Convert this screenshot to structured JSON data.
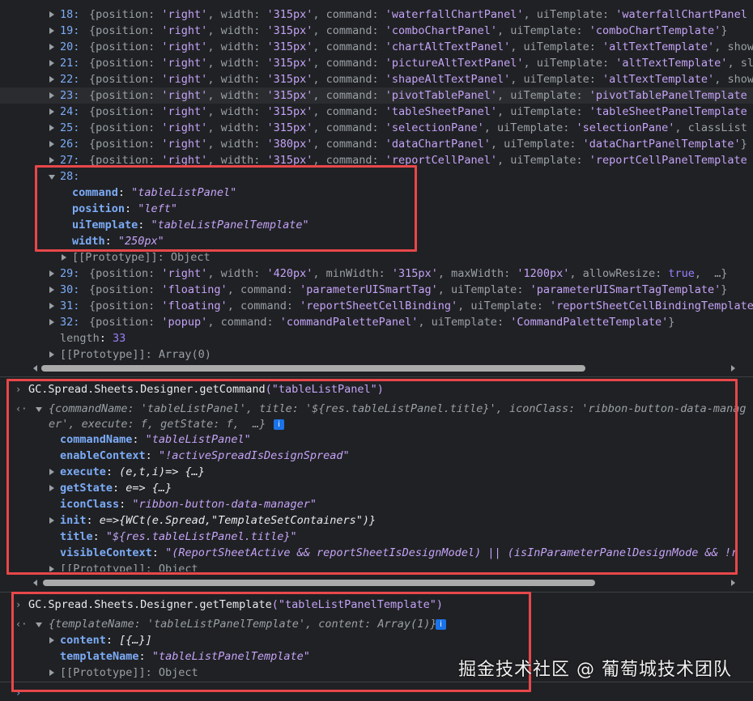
{
  "console": {
    "array_items": [
      {
        "index": "18:",
        "text": "{position: 'right', width: '315px', command: 'waterfallChartPanel', uiTemplate: 'waterfallChartPanel"
      },
      {
        "index": "19:",
        "text": "{position: 'right', width: '315px', command: 'comboChartPanel', uiTemplate: 'comboChartTemplate'}"
      },
      {
        "index": "20:",
        "text": "{position: 'right', width: '315px', command: 'chartAltTextPanel', uiTemplate: 'altTextTemplate', show"
      },
      {
        "index": "21:",
        "text": "{position: 'right', width: '315px', command: 'pictureAltTextPanel', uiTemplate: 'altTextTemplate', sl"
      },
      {
        "index": "22:",
        "text": "{position: 'right', width: '315px', command: 'shapeAltTextPanel', uiTemplate: 'altTextTemplate', show"
      },
      {
        "index": "23:",
        "text": "{position: 'right', width: '315px', command: 'pivotTablePanel', uiTemplate: 'pivotTablePanelTemplate"
      },
      {
        "index": "24:",
        "text": "{position: 'right', width: '315px', command: 'tableSheetPanel', uiTemplate: 'tableSheetPanelTemplate"
      },
      {
        "index": "25:",
        "text": "{position: 'right', width: '315px', command: 'selectionPane', uiTemplate: 'selectionPane', classList"
      },
      {
        "index": "26:",
        "text": "{position: 'right', width: '380px', command: 'dataChartPanel', uiTemplate: 'dataChartPanelTemplate'}"
      },
      {
        "index": "27:",
        "text": "{position: 'right', width: '315px', command: 'reportCellPanel', uiTemplate: 'reportCellPanelTemplate"
      }
    ],
    "item28": {
      "index": "28:",
      "props": [
        {
          "key": "command",
          "value": "\"tableListPanel\""
        },
        {
          "key": "position",
          "value": "\"left\""
        },
        {
          "key": "uiTemplate",
          "value": "\"tableListPanelTemplate\""
        },
        {
          "key": "width",
          "value": "\"250px\""
        }
      ],
      "prototype": "[[Prototype]]: Object"
    },
    "array_items_2": [
      {
        "index": "29:",
        "text": "{position: 'right', width: '420px', minWidth: '315px', maxWidth: '1200px', allowResize: true,  …}"
      },
      {
        "index": "30:",
        "text": "{position: 'floating', command: 'parameterUISmartTag', uiTemplate: 'parameterUISmartTagTemplate'}"
      },
      {
        "index": "31:",
        "text": "{position: 'floating', command: 'reportSheetCellBinding', uiTemplate: 'reportSheetCellBindingTemplate"
      },
      {
        "index": "32:",
        "text": "{position: 'popup', command: 'commandPalettePanel', uiTemplate: 'CommandPaletteTemplate'}"
      }
    ],
    "length_key": "length",
    "length_value": "33",
    "array_prototype": "[[Prototype]]: Array(0)",
    "cmd1": {
      "ns": "GC.",
      "call": "Spread.Sheets.Designer.getCommand",
      "arg": "(\"tableListPanel\")",
      "summary_1": "{commandName: 'tableListPanel', title: '${res.tableListPanel.title}', iconClass: 'ribbon-button-data-manag",
      "summary_2": "er', execute: f, getState: f,  …}",
      "props": [
        {
          "key": "commandName",
          "value": "\"tableListPanel\"",
          "expandable": false
        },
        {
          "key": "enableContext",
          "value": "\"!activeSpreadIsDesignSpread\"",
          "expandable": false
        },
        {
          "key": "execute",
          "value": "(e,t,i)=> {…}",
          "expandable": true
        },
        {
          "key": "getState",
          "value": "e=> {…}",
          "expandable": true
        },
        {
          "key": "iconClass",
          "value": "\"ribbon-button-data-manager\"",
          "expandable": false
        },
        {
          "key": "init",
          "value": "e=>{WCt(e.Spread,\"TemplateSetContainers\")}",
          "expandable": true
        },
        {
          "key": "title",
          "value": "\"${res.tableListPanel.title}\"",
          "expandable": false
        },
        {
          "key": "visibleContext",
          "value": "\"(ReportSheetActive && reportSheetIsDesignModel) || (isInParameterPanelDesignMode && !r",
          "expandable": false
        }
      ],
      "prototype": "[[Prototype]]: Object"
    },
    "cmd2": {
      "ns": "GC.",
      "call": "Spread.Sheets.Designer.getTemplate",
      "arg": "(\"tableListPanelTemplate\")",
      "summary": "{templateName: 'tableListPanelTemplate', content: Array(1)}",
      "props": [
        {
          "key": "content",
          "value": "[{…}]",
          "expandable": true
        },
        {
          "key": "templateName",
          "value": "\"tableListPanelTemplate\"",
          "expandable": false
        }
      ],
      "prototype": "[[Prototype]]: Object"
    },
    "info_badge": "i"
  },
  "watermark": "掘金技术社区 @ 葡萄城技术团队",
  "colors": {
    "background": "#202124",
    "highlight_box": "#e8474a",
    "key": "#7cacf8",
    "string": "#c4a3f7"
  }
}
